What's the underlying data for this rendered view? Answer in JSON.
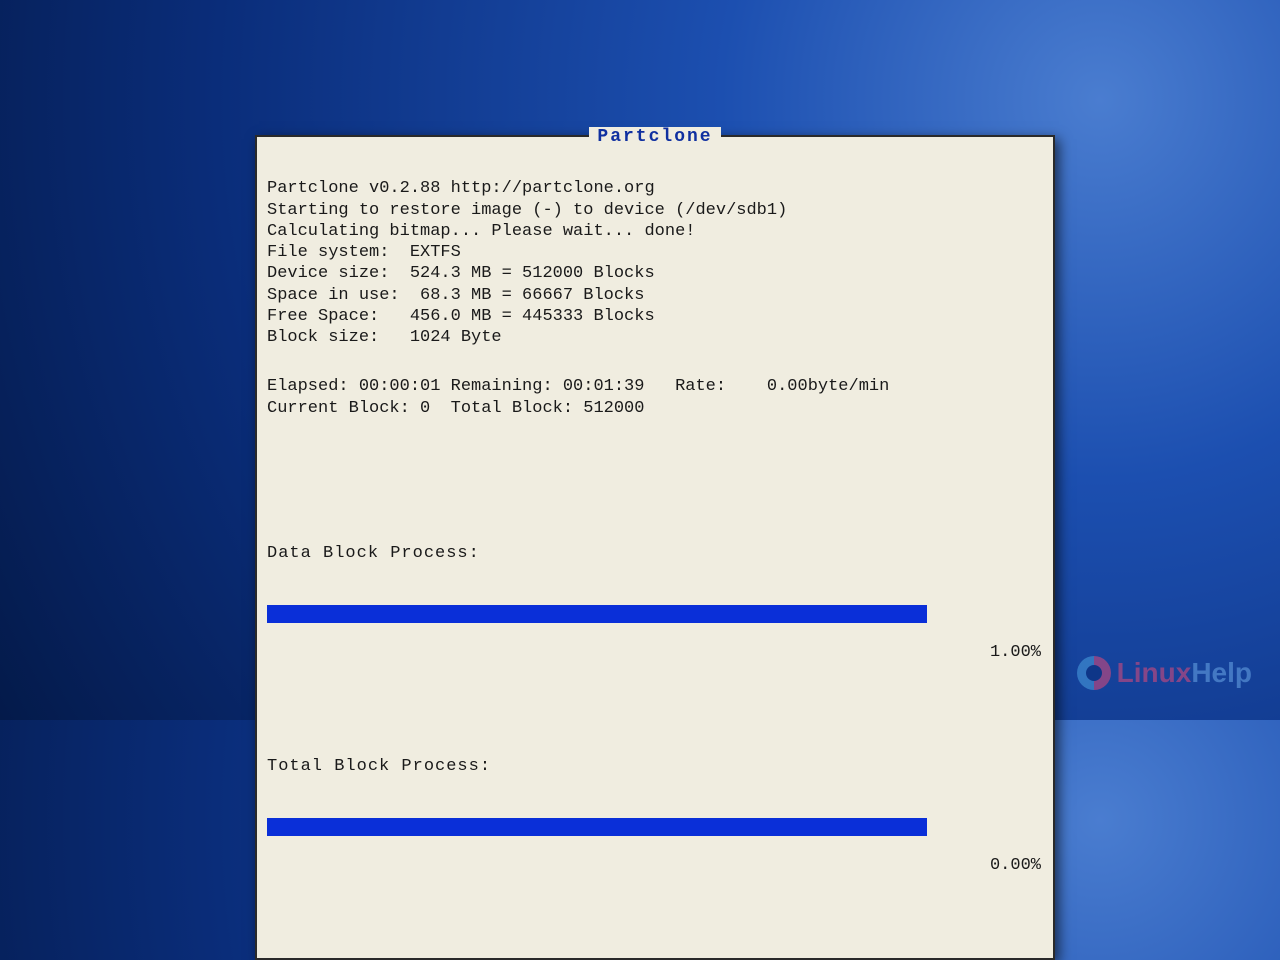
{
  "dialog": {
    "title": "Partclone",
    "lines": {
      "version": "Partclone v0.2.88 http://partclone.org",
      "action": "Starting to restore image (-) to device (/dev/sdb1)",
      "bitmap": "Calculating bitmap... Please wait... done!",
      "fs": "File system:  EXTFS",
      "dsize": "Device size:  524.3 MB = 512000 Blocks",
      "used": "Space in use:  68.3 MB = 66667 Blocks",
      "free": "Free Space:   456.0 MB = 445333 Blocks",
      "bsize": "Block size:   1024 Byte"
    },
    "status": {
      "line1": "Elapsed: 00:00:01 Remaining: 00:01:39   Rate:    0.00byte/min",
      "line2": "Current Block: 0  Total Block: 512000"
    },
    "progress": {
      "data": {
        "label": "Data Block Process:",
        "pct_text": "1.00%"
      },
      "total": {
        "label": "Total Block Process:",
        "pct_text": "0.00%"
      }
    }
  },
  "watermark": {
    "a": "Linux",
    "b": "Help"
  }
}
